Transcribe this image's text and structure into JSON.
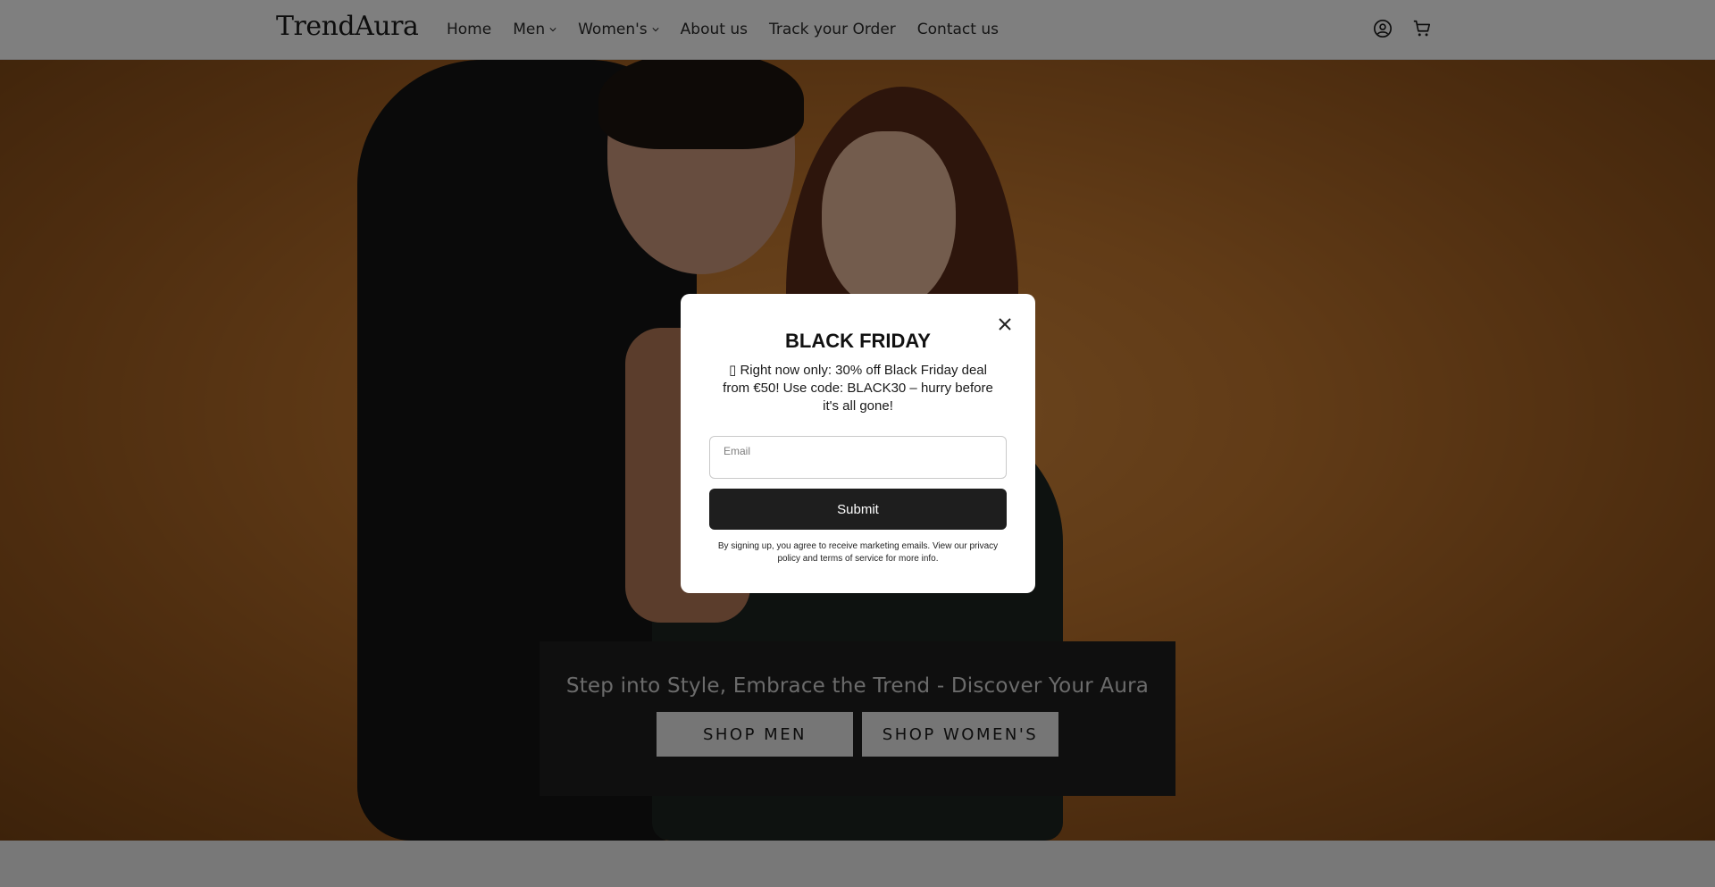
{
  "header": {
    "logo": "TrendAura",
    "nav": [
      {
        "label": "Home",
        "has_dropdown": false
      },
      {
        "label": "Men",
        "has_dropdown": true
      },
      {
        "label": "Women's",
        "has_dropdown": true
      },
      {
        "label": "About us",
        "has_dropdown": false
      },
      {
        "label": "Track your Order",
        "has_dropdown": false
      },
      {
        "label": "Contact us",
        "has_dropdown": false
      }
    ],
    "icons": [
      "account-icon",
      "cart-icon"
    ]
  },
  "hero": {
    "tagline": "Step into Style, Embrace the Trend - Discover Your Aura",
    "shop_men_label": "SHOP MEN",
    "shop_women_label": "SHOP WOMEN'S"
  },
  "modal": {
    "title": "BLACK FRIDAY",
    "message": "▯ Right now only: 30% off Black Friday deal from €50! Use code: BLACK30 – hurry before it's all gone!",
    "email_placeholder": "Email",
    "submit_label": "Submit",
    "disclaimer": "By signing up, you agree to receive marketing emails. View our privacy policy and terms of service for more info."
  },
  "colors": {
    "header_bg": "#ffffff",
    "hero_bg": "#c3772e",
    "banner_bg": "#1e1e1e",
    "submit_bg": "#1e1e1e",
    "overlay": "rgba(0,0,0,0.5)"
  }
}
